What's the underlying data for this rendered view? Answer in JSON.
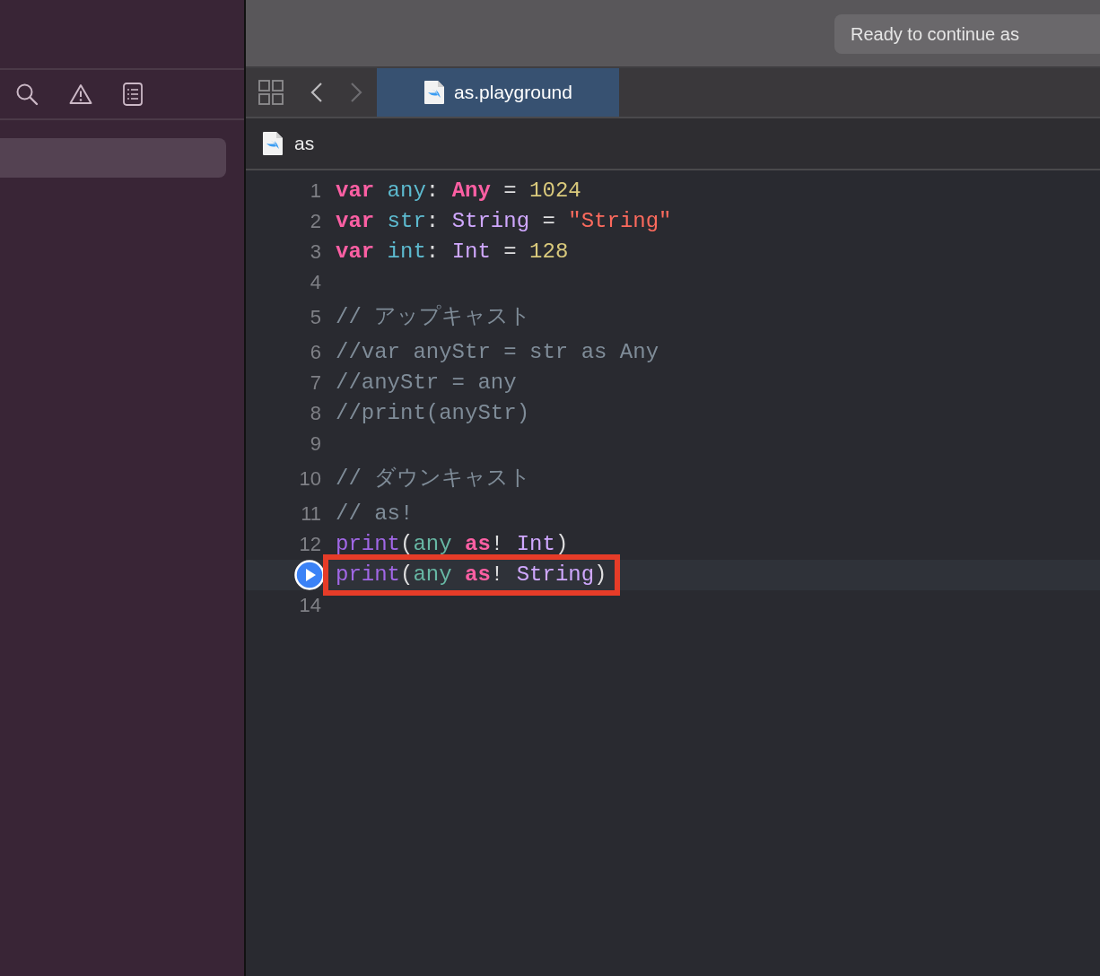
{
  "toolbar": {
    "status": "Ready to continue as"
  },
  "tabs": [
    {
      "label": "as.playground",
      "selected": true
    }
  ],
  "breadcrumb": {
    "label": "as"
  },
  "sidebar": {
    "items": [
      {
        "selected": true
      }
    ]
  },
  "editor": {
    "lines": [
      {
        "number": "1",
        "current": false,
        "highlighted": false,
        "tokens": [
          {
            "kind": "keyword",
            "text": "var"
          },
          {
            "kind": "decl",
            "text": " any"
          },
          {
            "kind": "plain",
            "text": ": "
          },
          {
            "kind": "keyword",
            "text": "Any"
          },
          {
            "kind": "plain",
            "text": " = "
          },
          {
            "kind": "number",
            "text": "1024"
          }
        ]
      },
      {
        "number": "2",
        "current": false,
        "highlighted": false,
        "tokens": [
          {
            "kind": "keyword",
            "text": "var"
          },
          {
            "kind": "decl",
            "text": " str"
          },
          {
            "kind": "plain",
            "text": ": "
          },
          {
            "kind": "type",
            "text": "String"
          },
          {
            "kind": "plain",
            "text": " = "
          },
          {
            "kind": "string",
            "text": "\"String\""
          }
        ]
      },
      {
        "number": "3",
        "current": false,
        "highlighted": false,
        "tokens": [
          {
            "kind": "keyword",
            "text": "var"
          },
          {
            "kind": "decl",
            "text": " int"
          },
          {
            "kind": "plain",
            "text": ": "
          },
          {
            "kind": "type",
            "text": "Int"
          },
          {
            "kind": "plain",
            "text": " = "
          },
          {
            "kind": "number",
            "text": "128"
          }
        ]
      },
      {
        "number": "4",
        "current": false
      },
      {
        "number": "5",
        "current": false,
        "highlighted": false,
        "tokens": [
          {
            "kind": "comment",
            "text": "// アップキャスト"
          }
        ]
      },
      {
        "number": "6",
        "current": false,
        "highlighted": false,
        "tokens": [
          {
            "kind": "comment",
            "text": "//var anyStr = str as Any"
          }
        ]
      },
      {
        "number": "7",
        "current": false,
        "highlighted": false,
        "tokens": [
          {
            "kind": "comment",
            "text": "//anyStr = any"
          }
        ]
      },
      {
        "number": "8",
        "current": false,
        "highlighted": false,
        "tokens": [
          {
            "kind": "comment",
            "text": "//print(anyStr)"
          }
        ]
      },
      {
        "number": "9",
        "current": false
      },
      {
        "number": "10",
        "current": false,
        "highlighted": false,
        "tokens": [
          {
            "kind": "comment",
            "text": "// ダウンキャスト"
          }
        ]
      },
      {
        "number": "11",
        "current": false,
        "highlighted": false,
        "tokens": [
          {
            "kind": "comment",
            "text": "// as!"
          }
        ]
      },
      {
        "number": "12",
        "current": false,
        "highlighted": false,
        "tokens": [
          {
            "kind": "func",
            "text": "print"
          },
          {
            "kind": "plain",
            "text": "("
          },
          {
            "kind": "ident",
            "text": "any"
          },
          {
            "kind": "keyword",
            "text": " as"
          },
          {
            "kind": "plain",
            "text": "! "
          },
          {
            "kind": "type",
            "text": "Int"
          },
          {
            "kind": "plain",
            "text": ")"
          }
        ]
      },
      {
        "current": true,
        "highlighted": true,
        "tokens": [
          {
            "kind": "func",
            "text": "print"
          },
          {
            "kind": "plain",
            "text": "("
          },
          {
            "kind": "ident",
            "text": "any"
          },
          {
            "kind": "keyword",
            "text": " as"
          },
          {
            "kind": "plain",
            "text": "! "
          },
          {
            "kind": "type",
            "text": "String"
          },
          {
            "kind": "plain",
            "text": ")"
          }
        ]
      },
      {
        "number": "14",
        "current": false
      }
    ]
  }
}
